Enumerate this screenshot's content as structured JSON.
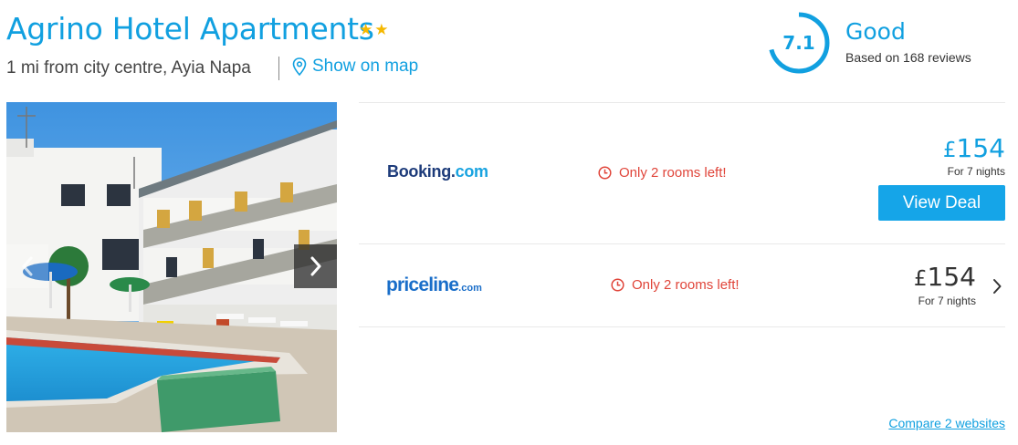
{
  "hotel": {
    "name": "Agrino Hotel Apartments",
    "star_rating": 2,
    "location": "1 mi from city centre, Ayia Napa",
    "map_link_label": "Show on map"
  },
  "rating": {
    "score": "7.1",
    "score_fraction": 0.71,
    "label": "Good",
    "reviews_text": "Based on 168 reviews"
  },
  "gallery": {
    "prev_icon": "chevron-left-icon",
    "next_icon": "chevron-right-icon"
  },
  "deals": [
    {
      "provider_main": "Booking",
      "provider_sep": ".",
      "provider_tld": "com",
      "availability": "Only 2 rooms left!",
      "currency": "£",
      "price": "154",
      "nights": "For 7 nights",
      "cta": "View Deal"
    },
    {
      "provider_main": "priceline",
      "provider_tld": ".com",
      "availability": "Only 2 rooms left!",
      "currency": "£",
      "price": "154",
      "nights": "For 7 nights"
    }
  ],
  "compare_link": "Compare 2 websites",
  "colors": {
    "brand_blue": "#11a0e0",
    "star_gold": "#f5b800",
    "alert_red": "#e0453a",
    "button_blue": "#15a5e8"
  }
}
